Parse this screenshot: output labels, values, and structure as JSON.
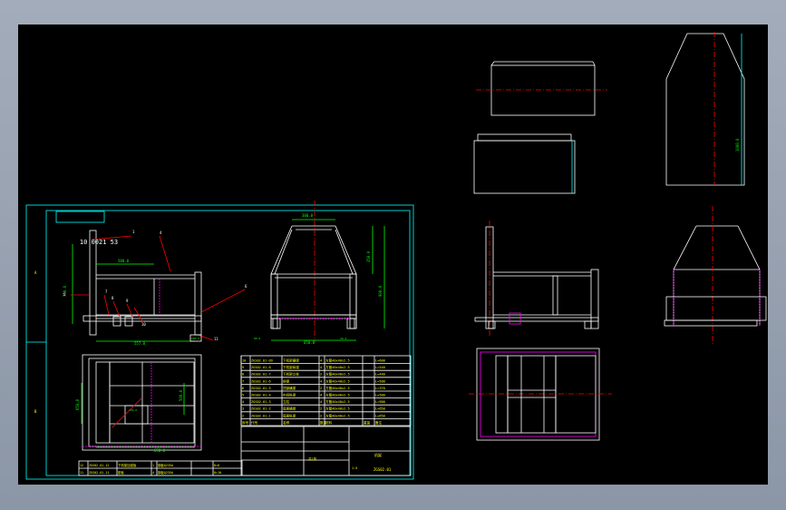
{
  "window": {
    "background": "#9aa4b3",
    "canvas_color": "#000000"
  },
  "colors": {
    "frame": "#00ffff",
    "structure": "#ffffff",
    "center_line": "#ff0000",
    "dimension": "#00ff00",
    "leader": "#ff0000",
    "highlight": "#ff00ff",
    "table_text": "#ffff00"
  },
  "sheet": {
    "title_box": "10 0021 53",
    "zone_labels": [
      "A",
      "B"
    ]
  },
  "dimensions": {
    "front_height": "750.0",
    "front_width": "557.0",
    "front_top": "500.0",
    "front_small": "200.0",
    "side_top": "380.0",
    "side_mid": "250.0",
    "side_height": "900.0",
    "side_base": "650.0",
    "side_feet_l": "80.0",
    "side_feet_r": "10.4",
    "plan_left": "650.0",
    "plan_right": "500.0",
    "plan_bottom": "650.0",
    "plan_inner": "150.0",
    "iso_height": "1000.0"
  },
  "balloons": [
    "1",
    "4",
    "5",
    "6",
    "7",
    "8",
    "9",
    "10",
    "11"
  ],
  "bom_rows": [
    [
      "10",
      "ZGS02.01-09",
      "下机架横梁",
      "4",
      "方管40x40x2.5",
      "",
      "L=600"
    ],
    [
      "9",
      "ZGS02.01-8",
      "下机架纵梁",
      "4",
      "方管40x40x2.5",
      "",
      "L=540"
    ],
    [
      "8",
      "ZGS02.01-7",
      "下机架立柱",
      "2",
      "方管40x40x2.5",
      "",
      "L=440"
    ],
    [
      "7",
      "ZGS02.01-6",
      "斜撑",
      "4",
      "方管40x40x2.5",
      "",
      "L=500"
    ],
    [
      "6",
      "ZGS02.01-5",
      "顶部横梁",
      "2",
      "方管40x40x2.5",
      "",
      "L=370"
    ],
    [
      "5",
      "ZGS02.01-4",
      "中间纵梁",
      "4",
      "方管40x40x2.5",
      "",
      "L=500"
    ],
    [
      "4",
      "ZGS02.01-3",
      "立柱",
      "4",
      "方管40x40x2.5",
      "",
      "L=900"
    ],
    [
      "3",
      "ZGS02.01-2",
      "底座横梁",
      "2",
      "方管40x40x2.5",
      "",
      "L=650"
    ],
    [
      "2",
      "ZGS02.01-1",
      "底座纵梁",
      "2",
      "方管40x40x2.5",
      "",
      "L=650"
    ]
  ],
  "bom_header": [
    "序号",
    "代号",
    "名称",
    "数量",
    "材料",
    "重量",
    "备注"
  ],
  "lower_rows": [
    [
      "12",
      "ZGS02.01-12",
      "下机架加强板",
      "1",
      "钢板Q235A",
      "",
      "δ=6"
    ],
    [
      "11",
      "ZGS02.01-11",
      "垫板",
      "4",
      "钢板Q235A",
      "",
      "δ=10"
    ]
  ],
  "title_block": {
    "name": "机架",
    "code": "ZGS02.01",
    "scale": "1:5",
    "sheet": "共1张"
  }
}
